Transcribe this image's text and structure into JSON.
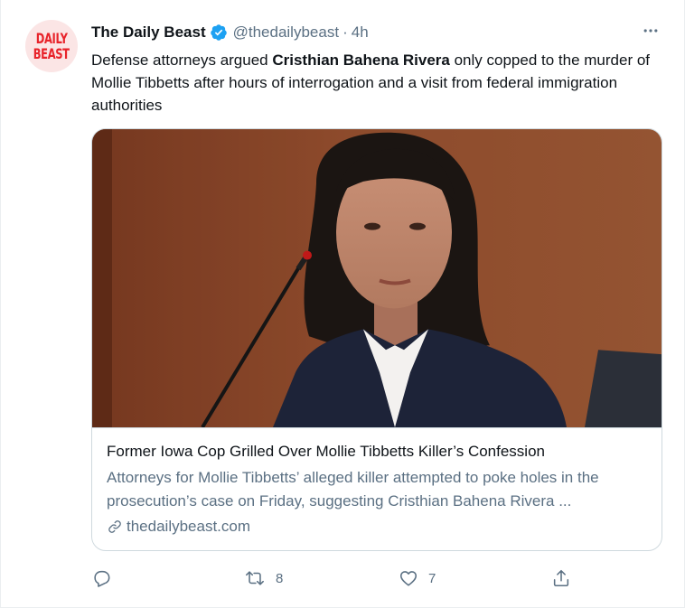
{
  "tweet": {
    "avatar_logo_line1": "DAILY",
    "avatar_logo_line2": "BEAST",
    "display_name": "The Daily Beast",
    "handle": "@thedailybeast",
    "separator": "·",
    "time": "4h",
    "text_before": "Defense attorneys argued ",
    "text_bold": "Cristhian Bahena Rivera",
    "text_after": " only copped to the murder of Mollie Tibbetts after hours of interrogation and a visit from federal immigration authorities"
  },
  "card": {
    "image_alt": "Woman testifying at a microphone in a courtroom",
    "title": "Former Iowa Cop Grilled Over Mollie Tibbetts Killer’s Confession",
    "description": "Attorneys for Mollie Tibbetts’ alleged killer attempted to poke holes in the prosecution’s case on Friday, suggesting Cristhian Bahena Rivera ...",
    "domain": "thedailybeast.com"
  },
  "actions": {
    "reply_count": "",
    "retweet_count": "8",
    "like_count": "7"
  },
  "icons": {
    "more": "more-icon",
    "verified": "verified-badge-icon",
    "reply": "reply-icon",
    "retweet": "retweet-icon",
    "like": "like-icon",
    "share": "share-icon",
    "link": "link-icon"
  },
  "colors": {
    "text": "#0f1419",
    "secondary": "#5b7083",
    "verified_blue": "#1da1f2",
    "brand_red": "#e8232a",
    "border": "#cfd9de"
  }
}
